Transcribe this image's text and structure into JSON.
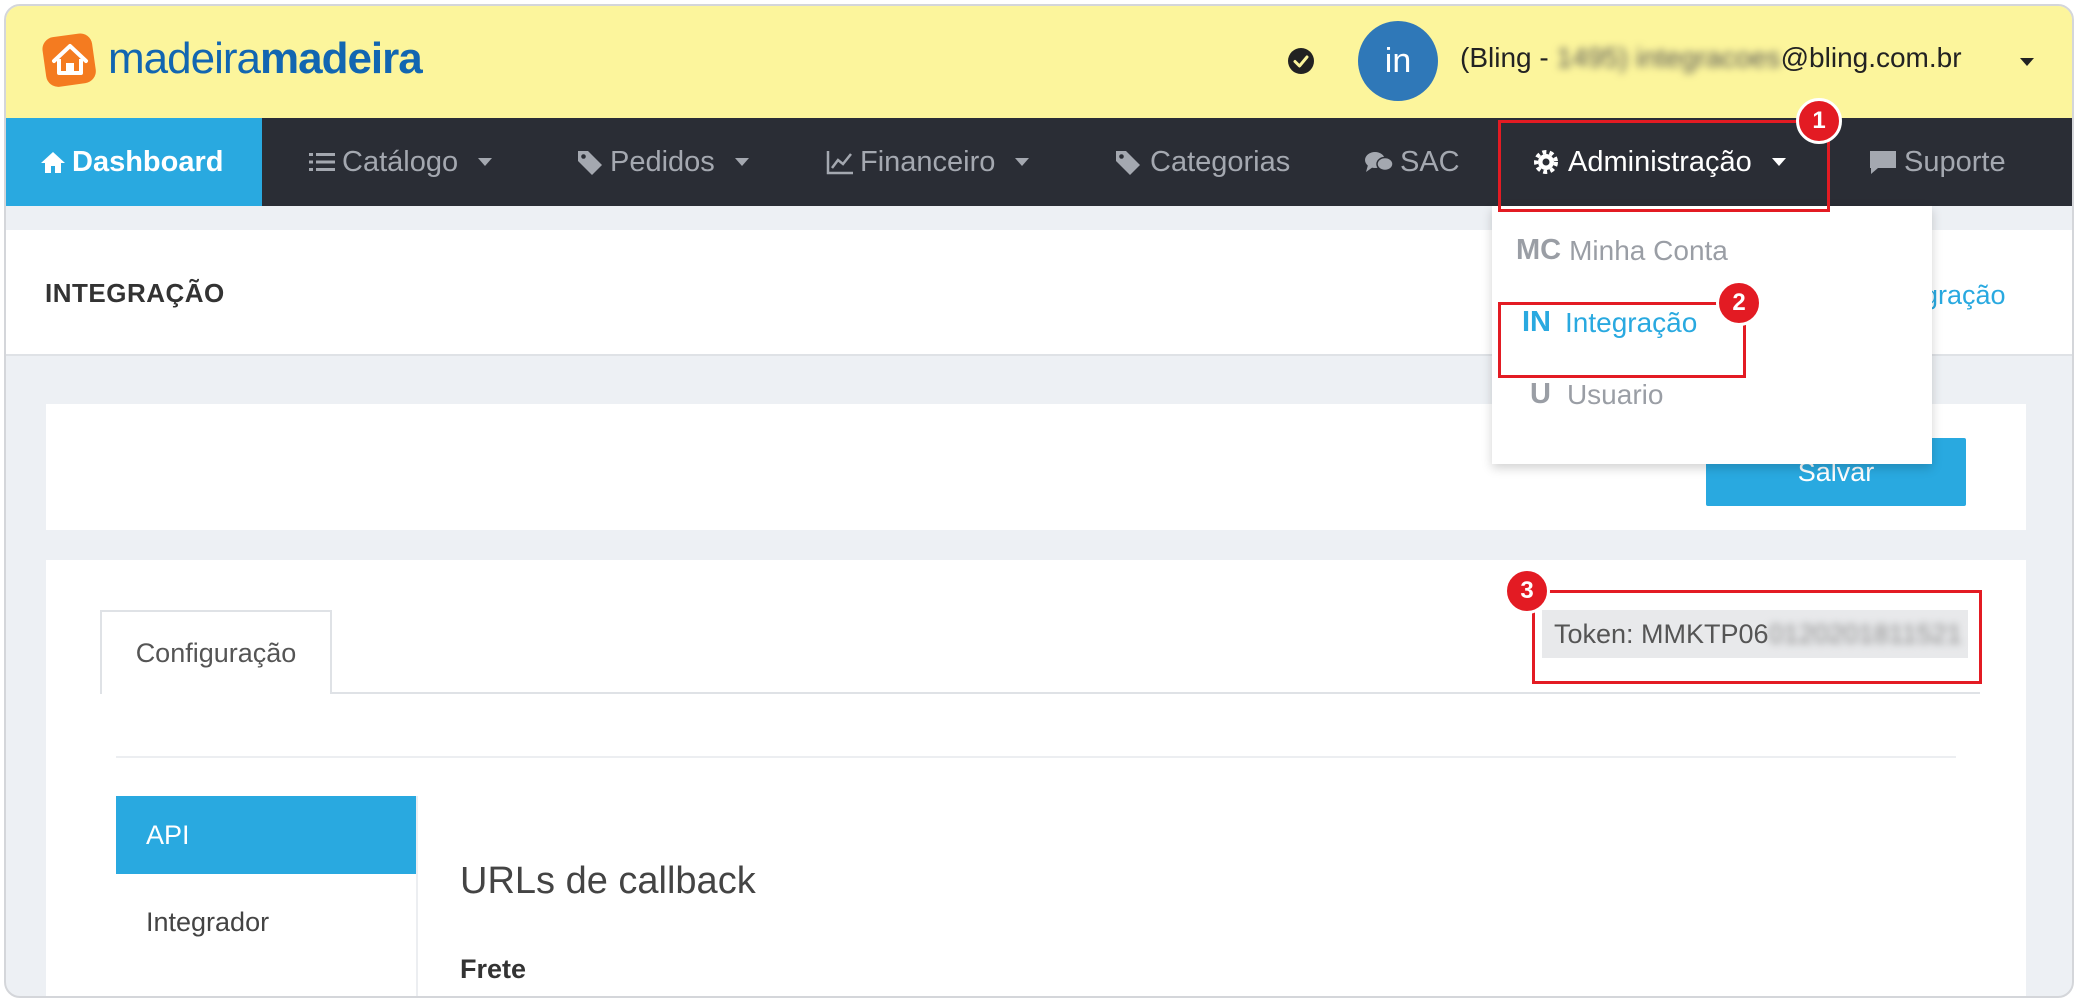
{
  "header": {
    "brand_light": "madeira",
    "brand_bold": "madeira",
    "avatar_initials": "in",
    "user_email_prefix": "(Bling - ",
    "user_email_redacted": "1495) integracoes",
    "user_email_suffix": "@bling.com.br"
  },
  "nav": {
    "items": [
      {
        "label": "Dashboard",
        "icon": "home-icon"
      },
      {
        "label": "Catálogo",
        "icon": "list-icon"
      },
      {
        "label": "Pedidos",
        "icon": "tag-icon"
      },
      {
        "label": "Financeiro",
        "icon": "line-chart-icon"
      },
      {
        "label": "Categorias",
        "icon": "tags-icon"
      },
      {
        "label": "SAC",
        "icon": "chat-icon"
      },
      {
        "label": "Administração",
        "icon": "gear-icon"
      },
      {
        "label": "Suporte",
        "icon": "comment-icon"
      }
    ]
  },
  "dropdown": {
    "items": [
      {
        "abbr": "MC",
        "label": "Minha Conta"
      },
      {
        "abbr": "IN",
        "label": "Integração"
      },
      {
        "abbr": "U",
        "label": "Usuario"
      }
    ]
  },
  "page": {
    "title": "INTEGRAÇÃO",
    "breadcrumb_partial": "egração",
    "save_label": "Salvar",
    "tab_label": "Configuração",
    "token_prefix": "Token: MMKTP06",
    "token_redacted": "0120201811521",
    "side_items": [
      "API",
      "Integrador"
    ],
    "section_title": "URLs de callback",
    "field_label": "Frete"
  },
  "annotations": [
    "1",
    "2",
    "3"
  ],
  "colors": {
    "topbar": "#fcf59c",
    "nav": "#2a2d35",
    "accent": "#29a9e0",
    "brand": "#1266b1",
    "logo_orange": "#f47b20",
    "annotation_red": "#e31b23"
  }
}
